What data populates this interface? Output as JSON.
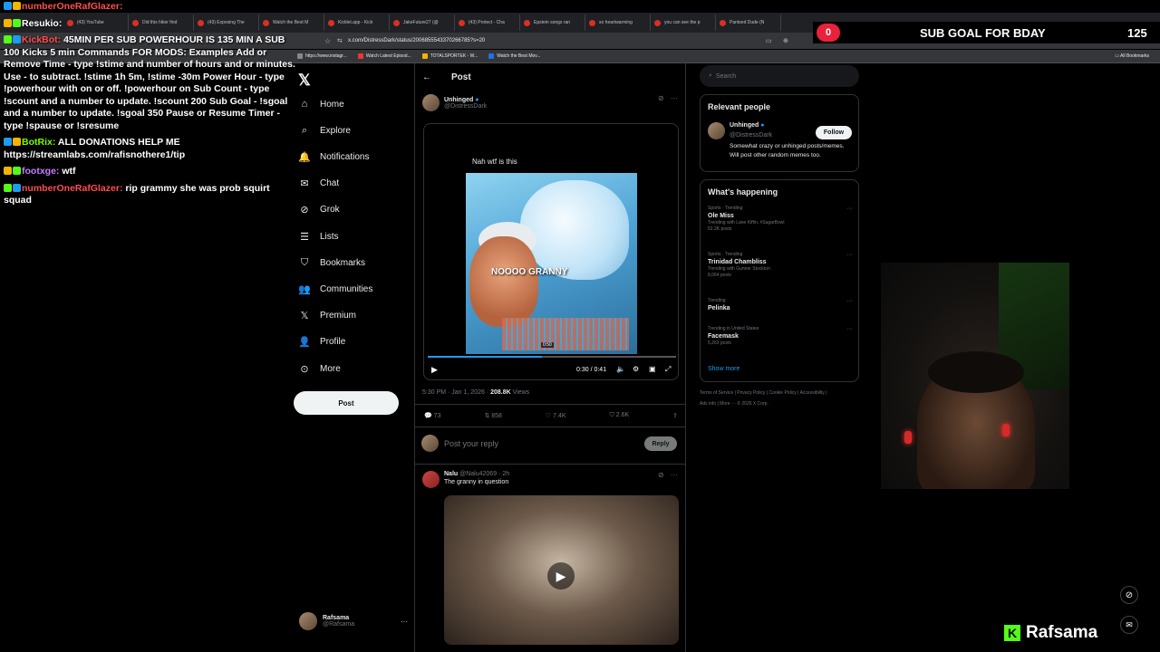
{
  "browser": {
    "tabs": [
      "(43) YouTube",
      "Did this hiker find",
      "(43) Exposing The",
      "Watch the Best M",
      "Kicklet.app - Kick",
      "JakeFuture27 (@",
      "(43) Protect - Cha",
      "Epstein songs ran",
      "so heartwarming",
      "you can see the p",
      "Pantsed Dude (N"
    ],
    "url": "x.com/DistressDark/status/2006855543370266785?s=20",
    "bookmarks": [
      "https://www.instagr...",
      "Watch Latest Episod...",
      "TOTALSPORTEK - W...",
      "Watch the Best Mov..."
    ],
    "all_bookmarks": "All Bookmarks"
  },
  "chat": [
    {
      "user": "numberOneRafGlazer:",
      "msg": "",
      "color": "#ff4d4d"
    },
    {
      "user": "Resukio:",
      "msg": "",
      "color": "#ffffff"
    },
    {
      "user": "KickBot:",
      "msg": "45MIN PER SUB POWERHOUR IS 135 MIN A SUB 100 Kicks 5 min Commands FOR MODS: Examples Add or Remove Time - type !stime and number of hours and or minutes. Use - to subtract. !stime 1h 5m, !stime -30m Power Hour - type !powerhour with on or off. !powerhour on Sub Count - type !scount and a number to update. !scount 200 Sub Goal - !sgoal and a number to update. !sgoal 350 Pause or Resume Timer - type !spause or !sresume",
      "color": "#ff4d4d"
    },
    {
      "user": "BotRix:",
      "msg": "ALL DONATIONS HELP ME https://streamlabs.com/rafisnothere1/tip",
      "color": "#7cfc00"
    },
    {
      "user": "footxge:",
      "msg": "wtf",
      "color": "#c77dff"
    },
    {
      "user": "numberOneRafGlazer:",
      "msg": "rip grammy she was prob squirt squad",
      "color": "#ff4d4d"
    }
  ],
  "nav": {
    "items": [
      "Home",
      "Explore",
      "Notifications",
      "Chat",
      "Grok",
      "Lists",
      "Bookmarks",
      "Communities",
      "Premium",
      "Profile",
      "More"
    ],
    "post_button": "Post"
  },
  "account": {
    "name": "Rafsama",
    "handle": "@Rafsama"
  },
  "post": {
    "header": "Post",
    "author_name": "Unhinged",
    "author_handle": "@DistressDark",
    "video_caption": "Nah wtf is this",
    "video_overlay": "NOOOO GRANNY",
    "video_time": "0:30 / 0:41",
    "scrub_time": "0:50",
    "timestamp": "5:30 PM · Jan 1, 2026 · ",
    "views": "208.8K",
    "views_label": " Views",
    "stats": {
      "replies": "73",
      "reposts": "858",
      "likes": "7.4K",
      "bookmarks": "2.6K"
    },
    "reply_placeholder": "Post your reply",
    "reply_button": "Reply"
  },
  "reply": {
    "name": "Nalu",
    "handle": "@Nalu42069 · 2h",
    "text": "The granny in question"
  },
  "search": {
    "placeholder": "Search"
  },
  "relevant": {
    "title": "Relevant people",
    "name": "Unhinged",
    "handle": "@DistressDark",
    "bio": "Somewhat crazy or unhinged posts/memes. Will post other random memes too.",
    "follow": "Follow"
  },
  "happening": {
    "title": "What's happening",
    "items": [
      {
        "cat": "Sports · Trending",
        "name": "Ole Miss",
        "extra": "Trending with Lane Kiffin, #SugarBowl",
        "count": "52.2K posts"
      },
      {
        "cat": "Sports · Trending",
        "name": "Trinidad Chambliss",
        "extra": "Trending with Gunner Stockton",
        "count": "8,064 posts"
      },
      {
        "cat": "Trending",
        "name": "Pelinka",
        "extra": "",
        "count": ""
      },
      {
        "cat": "Trending in United States",
        "name": "Facemask",
        "extra": "",
        "count": "5,263 posts"
      }
    ],
    "show_more": "Show more"
  },
  "footer": "Terms of Service | Privacy Policy | Cookie Policy | Accessibility | Ads info | More ··· © 2026 X Corp.",
  "overlay": {
    "sub_count_left": "0",
    "sub_goal_text": "SUB GOAL FOR BDAY",
    "sub_goal_number": "125",
    "streamer": "Rafsama"
  }
}
